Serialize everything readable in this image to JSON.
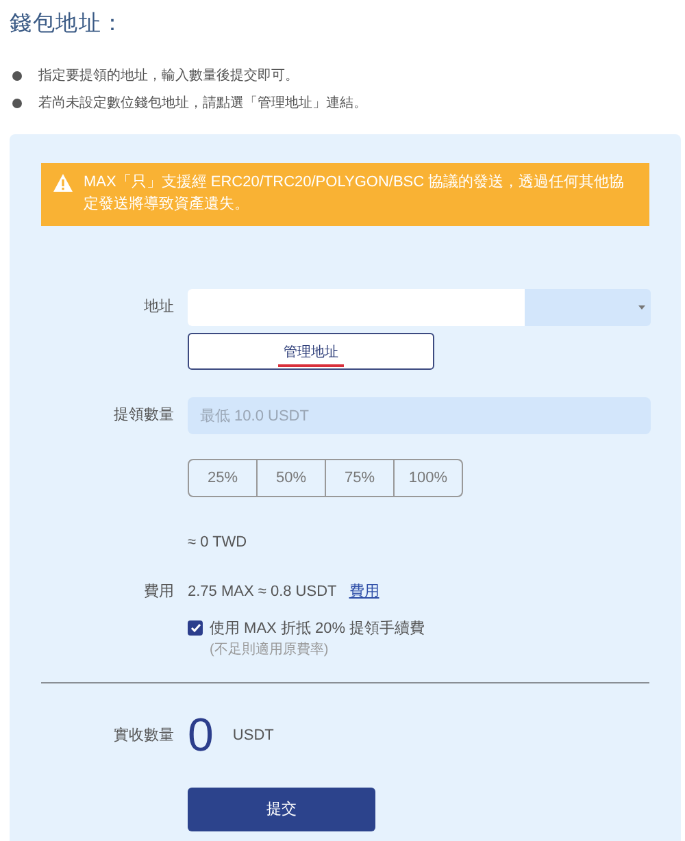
{
  "heading": "錢包地址：",
  "notes": [
    "指定要提領的地址，輸入數量後提交即可。",
    "若尚未設定數位錢包地址，請點選「管理地址」連結。"
  ],
  "warning": "MAX「只」支援經 ERC20/TRC20/POLYGON/BSC 協議的發送，透過任何其他協定發送將導致資產遺失。",
  "address": {
    "label": "地址",
    "manage_button": "管理地址"
  },
  "amount": {
    "label": "提領數量",
    "placeholder": "最低 10.0 USDT"
  },
  "percent_buttons": [
    "25%",
    "50%",
    "75%",
    "100%"
  ],
  "twd_estimate": "≈ 0 TWD",
  "fee": {
    "label": "費用",
    "value": "2.75 MAX ≈ 0.8 USDT",
    "link": "費用"
  },
  "max_discount": {
    "checked": true,
    "label": "使用 MAX 折抵 20% 提領手續費",
    "hint": "(不足則適用原費率)"
  },
  "received": {
    "label": "實收數量",
    "value": "0",
    "unit": "USDT"
  },
  "submit": "提交"
}
